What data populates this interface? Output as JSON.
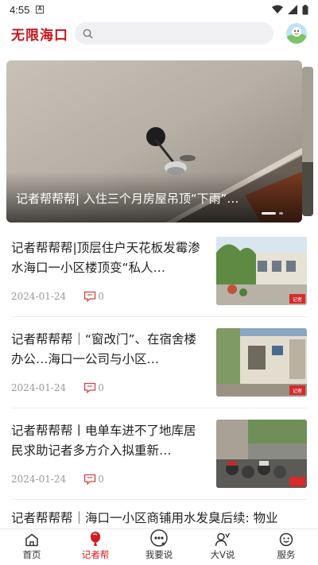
{
  "status_bar": {
    "time": "4:55",
    "notification_glyph": "A"
  },
  "header": {
    "logo": "无限海口",
    "search_placeholder": "",
    "colors": {
      "brand": "#c8151b"
    }
  },
  "banner": {
    "caption": "记者帮帮帮| 入住三个月房屋吊顶“下雨”…",
    "page_indicator": {
      "total": 2,
      "current": 1
    }
  },
  "news": [
    {
      "title": "记者帮帮帮|顶层住户天花板发霉渗水海口一小区楼顶变“私人…",
      "date": "2024-01-24",
      "comments": "0",
      "thumb_badge": "记者"
    },
    {
      "title": "记者帮帮帮｜“窗改门”、在宿舍楼办公…海口一公司与小区…",
      "date": "2024-01-24",
      "comments": "0",
      "thumb_badge": "记者"
    },
    {
      "title": "记者帮帮帮丨电单车进不了地库居民求助记者多方介入拟重新…",
      "date": "2024-01-24",
      "comments": "0",
      "thumb_badge": "记者"
    }
  ],
  "partial_news_title": "记者帮帮帮｜海口一小区商铺用水发臭后续: 物业",
  "tabbar": {
    "tabs": [
      {
        "label": "首页",
        "icon": "home-icon"
      },
      {
        "label": "记者帮",
        "icon": "reporter-help-icon"
      },
      {
        "label": "我要说",
        "icon": "speak-icon"
      },
      {
        "label": "大V说",
        "icon": "user-v-icon"
      },
      {
        "label": "服务",
        "icon": "service-icon"
      }
    ],
    "active": "记者帮",
    "colors": {
      "active": "#d71a21",
      "inactive": "#333333"
    }
  }
}
